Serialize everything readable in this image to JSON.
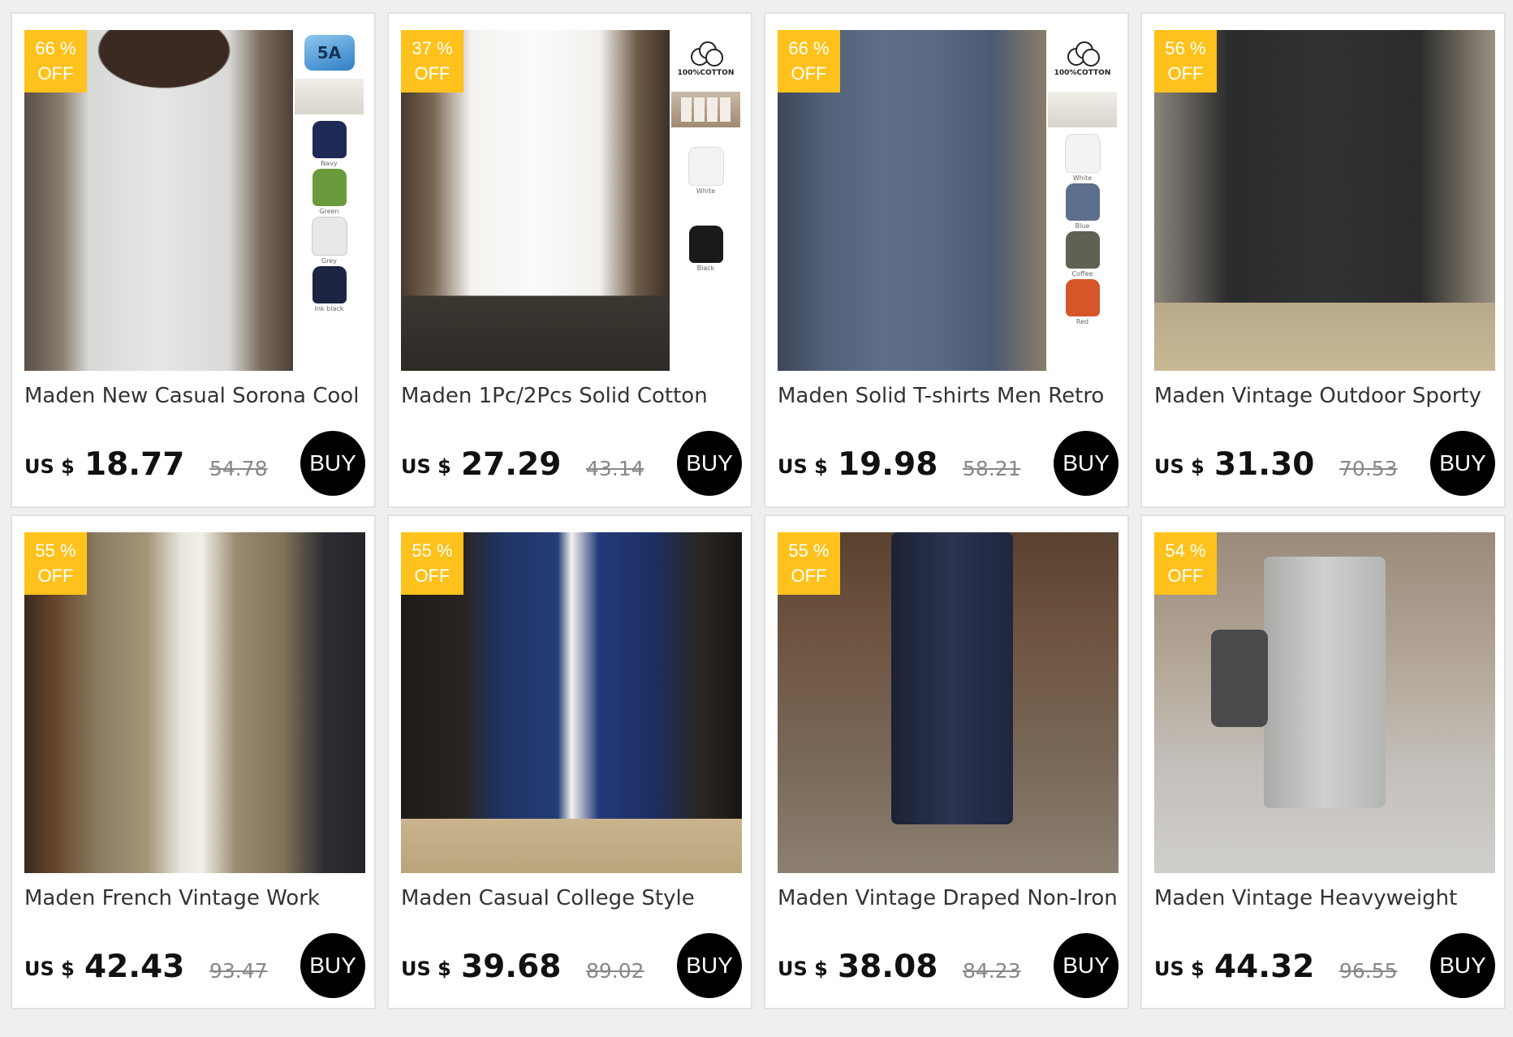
{
  "currency_label": "US $",
  "buy_label": "BUY",
  "off_label": "OFF",
  "products": [
    {
      "title": "Maden New Casual Sorona Cool",
      "price": "18.77",
      "old_price": "54.78",
      "discount": "66 %",
      "swatch_header": "5A",
      "swatches": [
        {
          "name": "Navy",
          "color": "#1d2a55"
        },
        {
          "name": "Green",
          "color": "#6a9a3c"
        },
        {
          "name": "Grey",
          "color": "#e8e8e8"
        },
        {
          "name": "Ink black",
          "color": "#1b2440"
        }
      ]
    },
    {
      "title": "Maden 1Pc/2Pcs Solid Cotton",
      "price": "27.29",
      "old_price": "43.14",
      "discount": "37 %",
      "swatch_header": "100%COTTON",
      "swatches": [
        {
          "name": "White",
          "color": "#f3f3f3"
        },
        {
          "name": "Black",
          "color": "#1a1a1a"
        }
      ]
    },
    {
      "title": "Maden Solid T-shirts Men Retro",
      "price": "19.98",
      "old_price": "58.21",
      "discount": "66 %",
      "swatch_header": "100%COTTON",
      "swatches": [
        {
          "name": "White",
          "color": "#f3f3f3"
        },
        {
          "name": "Blue",
          "color": "#5d6f8c"
        },
        {
          "name": "Coffee",
          "color": "#5f6152"
        },
        {
          "name": "Red",
          "color": "#d6562a"
        }
      ]
    },
    {
      "title": "Maden Vintage Outdoor Sporty",
      "price": "31.30",
      "old_price": "70.53",
      "discount": "56 %"
    },
    {
      "title": "Maden French Vintage Work",
      "price": "42.43",
      "old_price": "93.47",
      "discount": "55 %"
    },
    {
      "title": "Maden Casual College Style",
      "price": "39.68",
      "old_price": "89.02",
      "discount": "55 %"
    },
    {
      "title": "Maden Vintage Draped Non-Iron",
      "price": "38.08",
      "old_price": "84.23",
      "discount": "55 %"
    },
    {
      "title": "Maden Vintage Heavyweight",
      "price": "44.32",
      "old_price": "96.55",
      "discount": "54 %"
    }
  ],
  "colors": {
    "badge": "#ffc21c",
    "buy": "#000000",
    "page_bg": "#efefef"
  }
}
